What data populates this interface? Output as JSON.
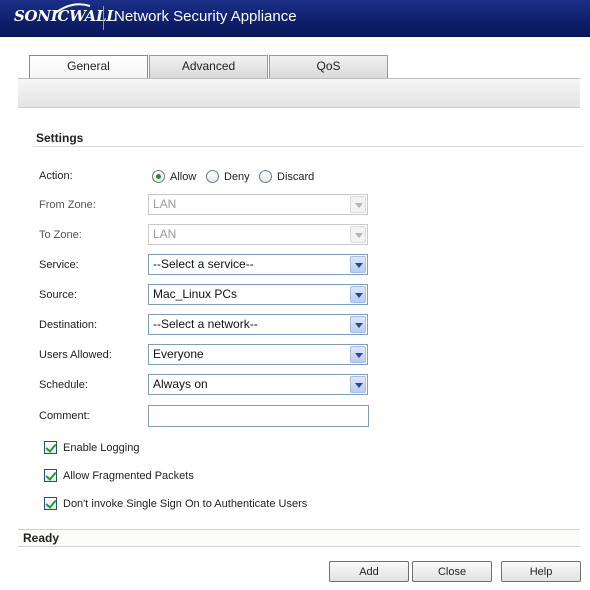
{
  "header": {
    "logo_text": "SONICWALL",
    "title": "Network Security Appliance"
  },
  "tabs": [
    {
      "label": "General",
      "active": true
    },
    {
      "label": "Advanced",
      "active": false
    },
    {
      "label": "QoS",
      "active": false
    }
  ],
  "settings": {
    "title": "Settings",
    "action": {
      "label": "Action:",
      "options": [
        "Allow",
        "Deny",
        "Discard"
      ],
      "selected": "Allow"
    },
    "from_zone": {
      "label": "From Zone:",
      "value": "LAN",
      "disabled": true
    },
    "to_zone": {
      "label": "To Zone:",
      "value": "LAN",
      "disabled": true
    },
    "service": {
      "label": "Service:",
      "value": "--Select a service--"
    },
    "source": {
      "label": "Source:",
      "value": "Mac_Linux PCs"
    },
    "destination": {
      "label": "Destination:",
      "value": "--Select a network--"
    },
    "users_allowed": {
      "label": "Users Allowed:",
      "value": "Everyone"
    },
    "schedule": {
      "label": "Schedule:",
      "value": "Always on"
    },
    "comment": {
      "label": "Comment:",
      "value": ""
    },
    "checkboxes": [
      {
        "label": "Enable Logging",
        "checked": true
      },
      {
        "label": "Allow Fragmented Packets",
        "checked": true
      },
      {
        "label": "Don't invoke Single Sign On to Authenticate Users",
        "checked": true
      }
    ]
  },
  "status": {
    "text": "Ready"
  },
  "buttons": {
    "add": "Add",
    "close": "Close",
    "help": "Help"
  },
  "colors": {
    "header_bg": "#0f1f6b",
    "checkmark": "#21a121",
    "radio_dot": "#2a8a2a"
  }
}
